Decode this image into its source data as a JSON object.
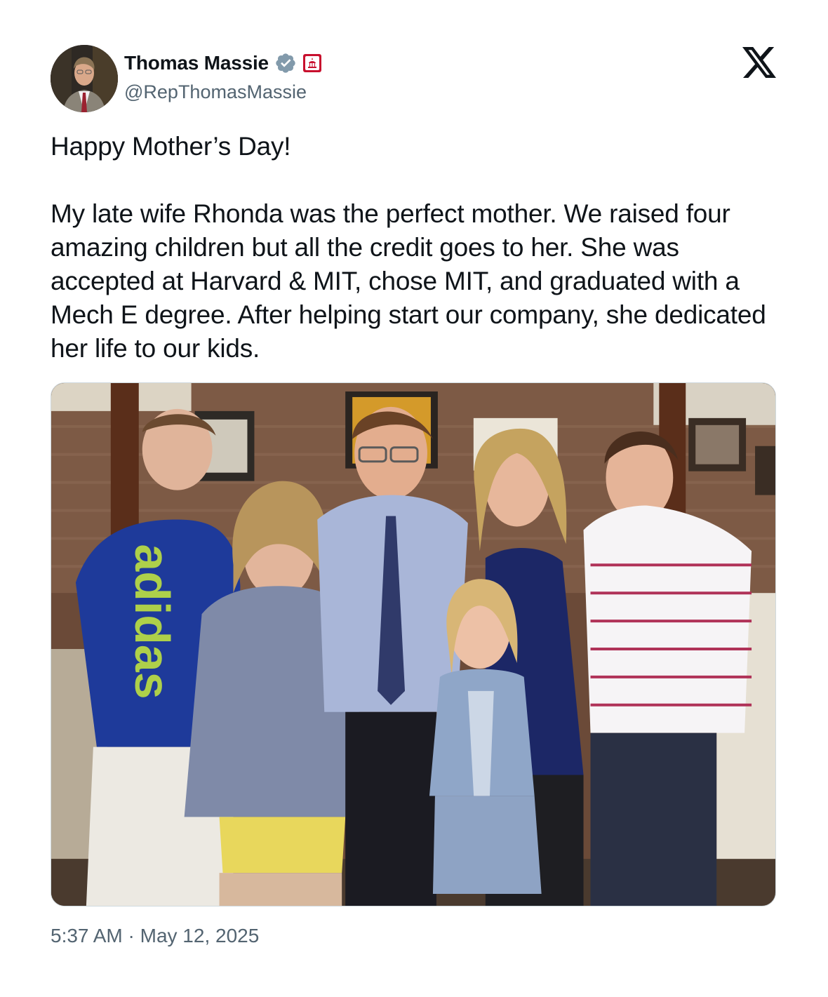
{
  "author": {
    "display_name": "Thomas Massie",
    "handle": "@RepThomasMassie",
    "verified_icon": "verified-badge-icon",
    "affiliation_icon": "us-government-badge-icon",
    "avatar": "profile-photo"
  },
  "brand": {
    "logo": "x-logo-icon"
  },
  "tweet": {
    "greeting": "Happy Mother’s Day!",
    "body": "My late wife Rhonda was the perfect mother. We raised four amazing children but all the credit goes to her. She was accepted at Harvard & MIT, chose MIT, and graduated with a Mech E degree. After helping start our company, she dedicated her life to our kids.",
    "time": "5:37 AM",
    "separator": " · ",
    "date": "May 12, 2025"
  },
  "media": {
    "shirt_text": "adidas"
  },
  "colors": {
    "text_primary": "#0f1419",
    "text_secondary": "#536471",
    "verified": "#829aab",
    "gov_badge": "#c8102e"
  }
}
